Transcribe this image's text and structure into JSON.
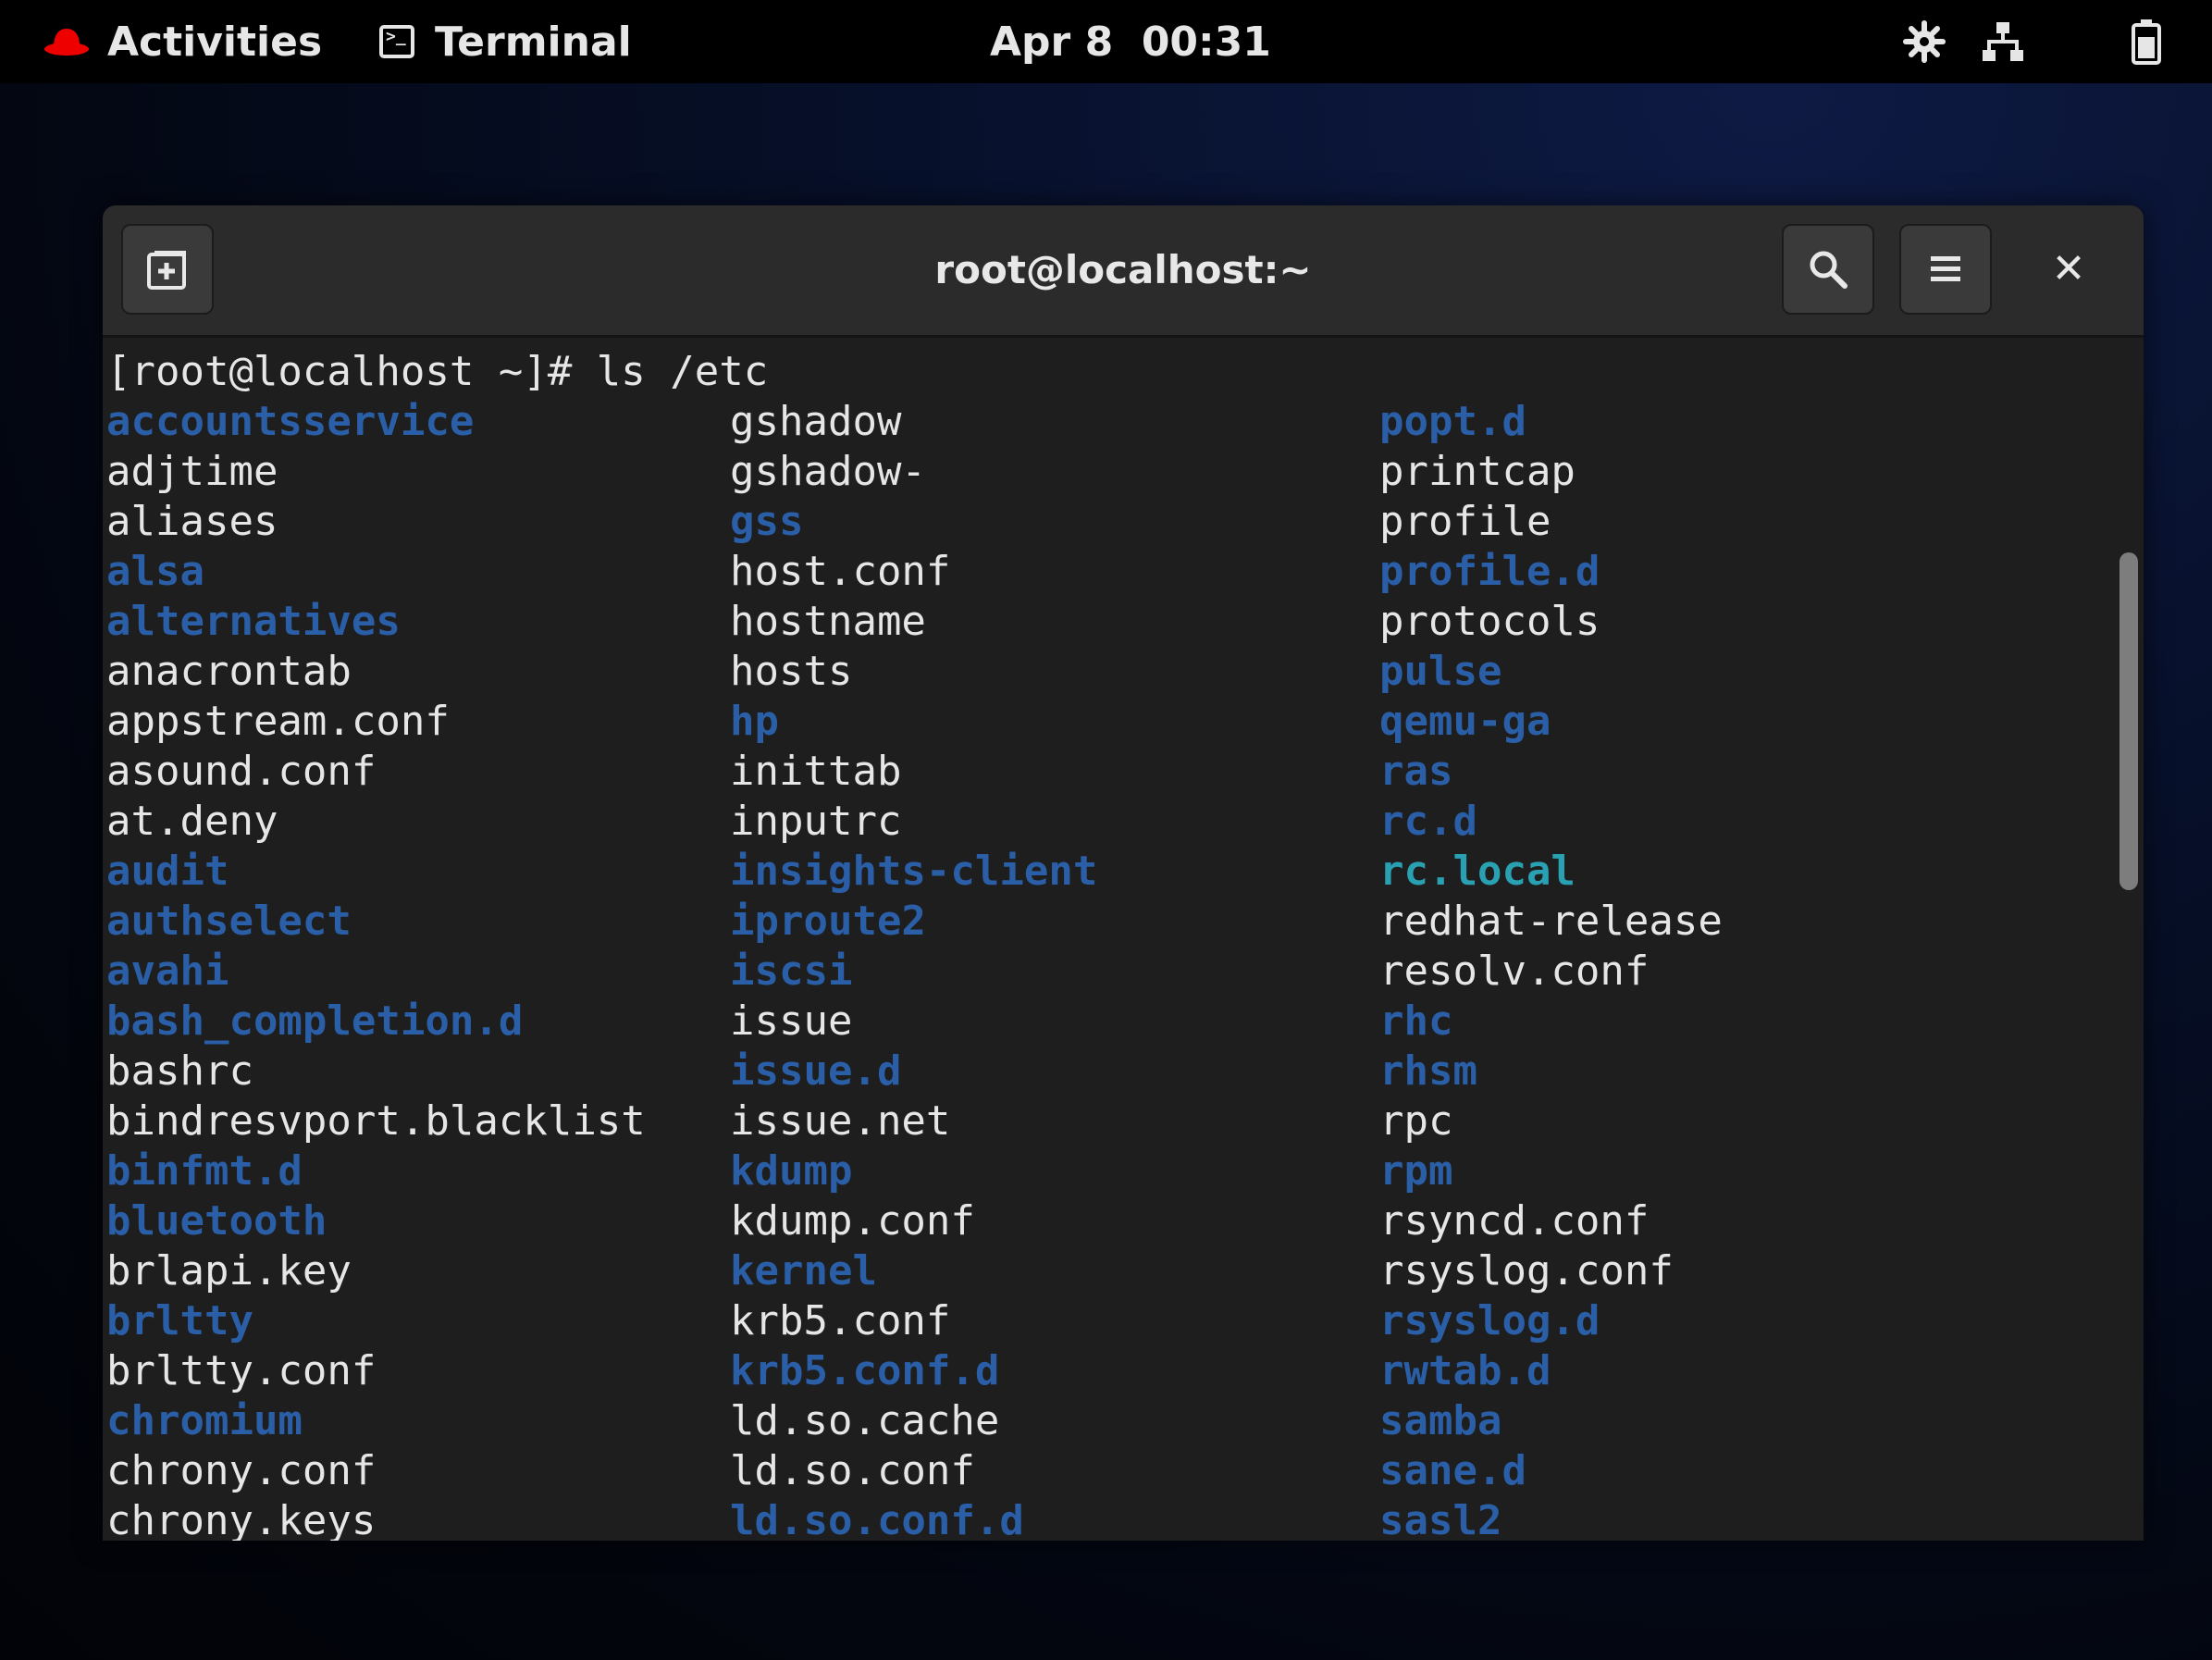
{
  "topbar": {
    "activities_label": "Activities",
    "app_label": "Terminal",
    "clock": "Apr 8  00:31",
    "tray": [
      "settings-icon",
      "network-icon",
      "battery-icon"
    ]
  },
  "window": {
    "title": "root@localhost:~",
    "buttons": [
      "new-tab-icon",
      "search-icon",
      "menu-icon",
      "close-icon"
    ],
    "close_glyph": "✕"
  },
  "terminal": {
    "prompt": "[root@localhost ~]# ls /etc",
    "colors": {
      "directory": "#2a5fa8",
      "executable": "#2aa1b3",
      "file": "#e6e6e6"
    },
    "columns": [
      [
        {
          "name": "accountsservice",
          "type": "dir"
        },
        {
          "name": "adjtime",
          "type": "file"
        },
        {
          "name": "aliases",
          "type": "file"
        },
        {
          "name": "alsa",
          "type": "dir"
        },
        {
          "name": "alternatives",
          "type": "dir"
        },
        {
          "name": "anacrontab",
          "type": "file"
        },
        {
          "name": "appstream.conf",
          "type": "file"
        },
        {
          "name": "asound.conf",
          "type": "file"
        },
        {
          "name": "at.deny",
          "type": "file"
        },
        {
          "name": "audit",
          "type": "dir"
        },
        {
          "name": "authselect",
          "type": "dir"
        },
        {
          "name": "avahi",
          "type": "dir"
        },
        {
          "name": "bash_completion.d",
          "type": "dir"
        },
        {
          "name": "bashrc",
          "type": "file"
        },
        {
          "name": "bindresvport.blacklist",
          "type": "file"
        },
        {
          "name": "binfmt.d",
          "type": "dir"
        },
        {
          "name": "bluetooth",
          "type": "dir"
        },
        {
          "name": "brlapi.key",
          "type": "file"
        },
        {
          "name": "brltty",
          "type": "dir"
        },
        {
          "name": "brltty.conf",
          "type": "file"
        },
        {
          "name": "chromium",
          "type": "dir"
        },
        {
          "name": "chrony.conf",
          "type": "file"
        },
        {
          "name": "chrony.keys",
          "type": "file"
        }
      ],
      [
        {
          "name": "gshadow",
          "type": "file"
        },
        {
          "name": "gshadow-",
          "type": "file"
        },
        {
          "name": "gss",
          "type": "dir"
        },
        {
          "name": "host.conf",
          "type": "file"
        },
        {
          "name": "hostname",
          "type": "file"
        },
        {
          "name": "hosts",
          "type": "file"
        },
        {
          "name": "hp",
          "type": "dir"
        },
        {
          "name": "inittab",
          "type": "file"
        },
        {
          "name": "inputrc",
          "type": "file"
        },
        {
          "name": "insights-client",
          "type": "dir"
        },
        {
          "name": "iproute2",
          "type": "dir"
        },
        {
          "name": "iscsi",
          "type": "dir"
        },
        {
          "name": "issue",
          "type": "file"
        },
        {
          "name": "issue.d",
          "type": "dir"
        },
        {
          "name": "issue.net",
          "type": "file"
        },
        {
          "name": "kdump",
          "type": "dir"
        },
        {
          "name": "kdump.conf",
          "type": "file"
        },
        {
          "name": "kernel",
          "type": "dir"
        },
        {
          "name": "krb5.conf",
          "type": "file"
        },
        {
          "name": "krb5.conf.d",
          "type": "dir"
        },
        {
          "name": "ld.so.cache",
          "type": "file"
        },
        {
          "name": "ld.so.conf",
          "type": "file"
        },
        {
          "name": "ld.so.conf.d",
          "type": "dir"
        }
      ],
      [
        {
          "name": "popt.d",
          "type": "dir"
        },
        {
          "name": "printcap",
          "type": "file"
        },
        {
          "name": "profile",
          "type": "file"
        },
        {
          "name": "profile.d",
          "type": "dir"
        },
        {
          "name": "protocols",
          "type": "file"
        },
        {
          "name": "pulse",
          "type": "dir"
        },
        {
          "name": "qemu-ga",
          "type": "dir"
        },
        {
          "name": "ras",
          "type": "dir"
        },
        {
          "name": "rc.d",
          "type": "dir"
        },
        {
          "name": "rc.local",
          "type": "exec"
        },
        {
          "name": "redhat-release",
          "type": "file"
        },
        {
          "name": "resolv.conf",
          "type": "file"
        },
        {
          "name": "rhc",
          "type": "dir"
        },
        {
          "name": "rhsm",
          "type": "dir"
        },
        {
          "name": "rpc",
          "type": "file"
        },
        {
          "name": "rpm",
          "type": "dir"
        },
        {
          "name": "rsyncd.conf",
          "type": "file"
        },
        {
          "name": "rsyslog.conf",
          "type": "file"
        },
        {
          "name": "rsyslog.d",
          "type": "dir"
        },
        {
          "name": "rwtab.d",
          "type": "dir"
        },
        {
          "name": "samba",
          "type": "dir"
        },
        {
          "name": "sane.d",
          "type": "dir"
        },
        {
          "name": "sasl2",
          "type": "dir"
        }
      ]
    ]
  }
}
